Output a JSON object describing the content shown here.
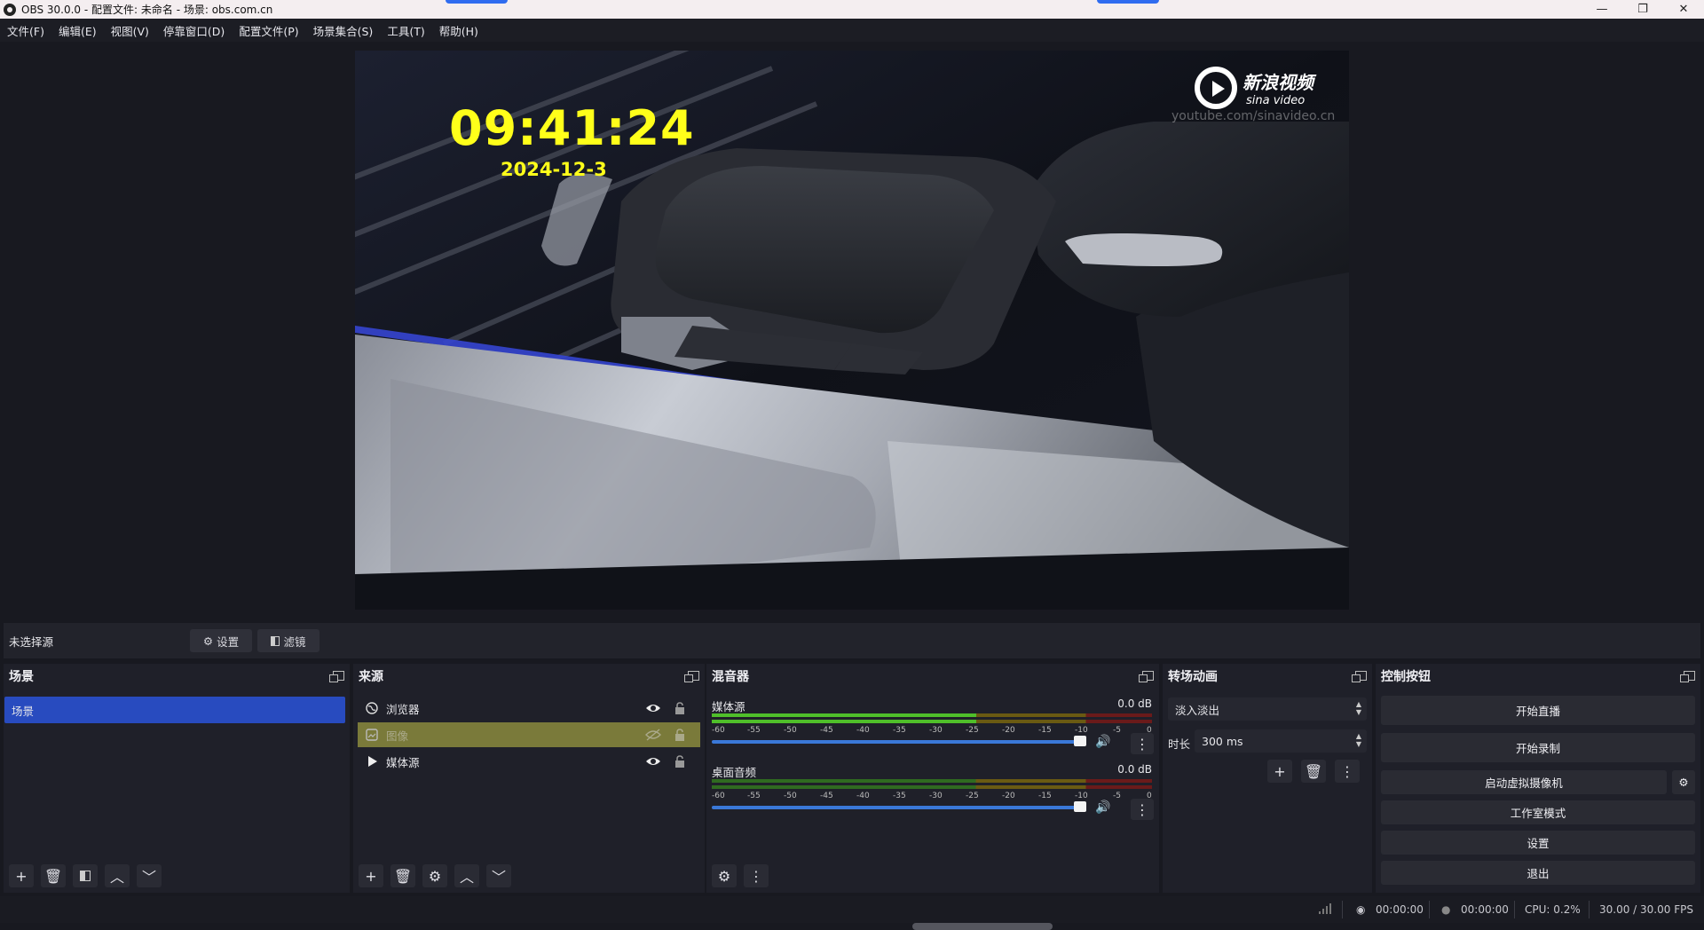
{
  "window": {
    "title": "OBS 30.0.0 - 配置文件: 未命名 - 场景: obs.com.cn",
    "minimize": "—",
    "restore": "❐",
    "close": "✕"
  },
  "menu": [
    "文件(F)",
    "编辑(E)",
    "视图(V)",
    "停靠窗口(D)",
    "配置文件(P)",
    "场景集合(S)",
    "工具(T)",
    "帮助(H)"
  ],
  "preview": {
    "clock_time": "09:41:24",
    "clock_date": "2024-12-3",
    "watermark_cn": "新浪视频",
    "watermark_en": "sina video",
    "watermark_url": "youtube.com/sinavideo.cn"
  },
  "source_bar": {
    "no_selection": "未选择源",
    "settings_label": "设置",
    "filters_label": "滤镜"
  },
  "scenes": {
    "title": "场景",
    "items": [
      "场景"
    ]
  },
  "sources": {
    "title": "来源",
    "items": [
      {
        "name": "浏览器",
        "icon": "globe-icon",
        "visible": true,
        "selected": false
      },
      {
        "name": "图像",
        "icon": "image-icon",
        "visible": false,
        "selected": true
      },
      {
        "name": "媒体源",
        "icon": "play-icon",
        "visible": true,
        "selected": false
      }
    ]
  },
  "mixer": {
    "title": "混音器",
    "channels": [
      {
        "name": "媒体源",
        "db": "0.0 dB",
        "level": 0.6
      },
      {
        "name": "桌面音频",
        "db": "0.0 dB",
        "level": 0.0
      }
    ],
    "scale": [
      "-60",
      "-55",
      "-50",
      "-45",
      "-40",
      "-35",
      "-30",
      "-25",
      "-20",
      "-15",
      "-10",
      "-5",
      "0"
    ]
  },
  "transitions": {
    "title": "转场动画",
    "selected": "淡入淡出",
    "duration_label": "时长",
    "duration_value": "300 ms"
  },
  "controls": {
    "title": "控制按钮",
    "start_stream": "开始直播",
    "start_record": "开始录制",
    "start_virtualcam": "启动虚拟摄像机",
    "studio_mode": "工作室模式",
    "settings": "设置",
    "exit": "退出"
  },
  "status": {
    "live_time": "00:00:00",
    "rec_time": "00:00:00",
    "cpu": "CPU: 0.2%",
    "fps": "30.00 / 30.00 FPS"
  },
  "colors": {
    "accent": "#284bbf",
    "clock": "#ffff1a",
    "selected_source": "#7a7a3a"
  }
}
